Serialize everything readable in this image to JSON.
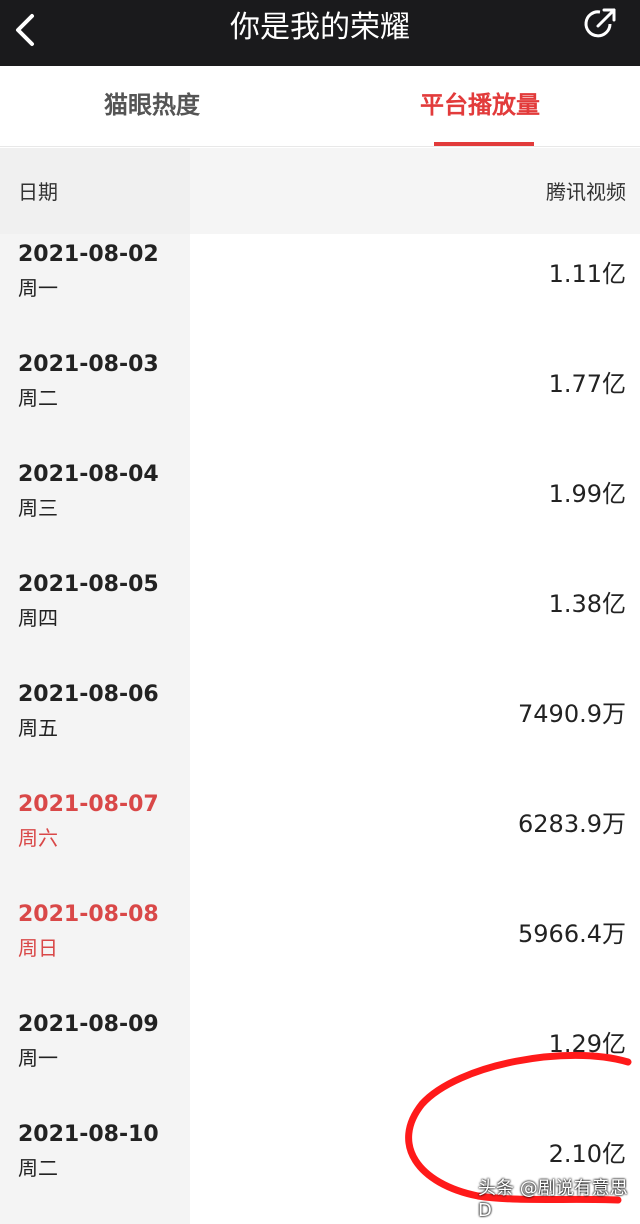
{
  "header": {
    "title": "你是我的荣耀",
    "back_icon": "chevron-left-icon",
    "share_icon": "share-icon"
  },
  "tabs": [
    {
      "label": "猫眼热度",
      "active": false
    },
    {
      "label": "平台播放量",
      "active": true
    }
  ],
  "table": {
    "col_date": "日期",
    "col_platform": "腾讯视频",
    "rows": [
      {
        "date": "2021-08-02",
        "weekday": "周一",
        "value": "1.11亿"
      },
      {
        "date": "2021-08-03",
        "weekday": "周二",
        "value": "1.77亿"
      },
      {
        "date": "2021-08-04",
        "weekday": "周三",
        "value": "1.99亿"
      },
      {
        "date": "2021-08-05",
        "weekday": "周四",
        "value": "1.38亿"
      },
      {
        "date": "2021-08-06",
        "weekday": "周五",
        "value": "7490.9万"
      },
      {
        "date": "2021-08-07",
        "weekday": "周六",
        "value": "6283.9万"
      },
      {
        "date": "2021-08-08",
        "weekday": "周日",
        "value": "5966.4万"
      },
      {
        "date": "2021-08-09",
        "weekday": "周一",
        "value": "1.29亿"
      },
      {
        "date": "2021-08-10",
        "weekday": "周二",
        "value": "2.10亿"
      }
    ]
  },
  "watermark": "头条 @剧说有意思D",
  "colors": {
    "accent": "#e23b3b",
    "weekend": "#d94848",
    "topbar": "#1a1a1c"
  }
}
